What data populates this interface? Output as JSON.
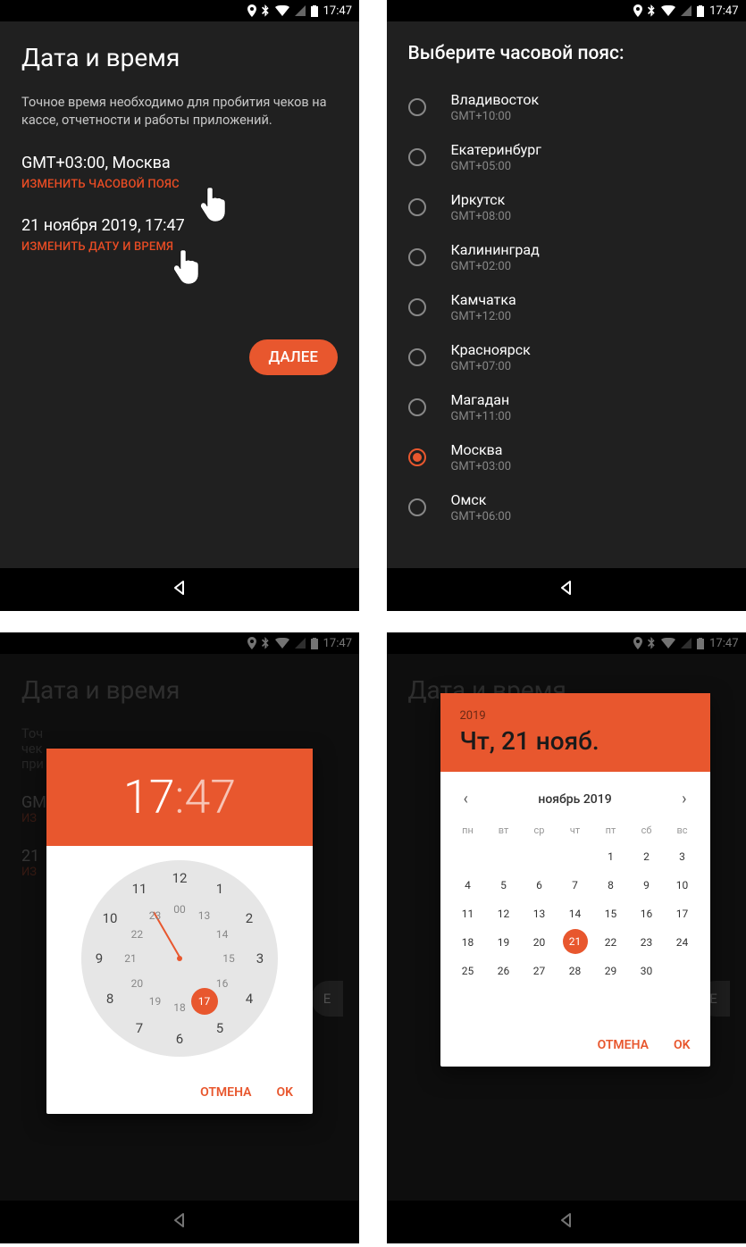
{
  "accent": "#e8572e",
  "status": {
    "time": "17:47"
  },
  "screen1": {
    "title": "Дата и время",
    "desc": "Точное время необходимо для пробития чеков на кассе, отчетности и работы приложений.",
    "tz_value": "GMT+03:00, Москва",
    "tz_link": "ИЗМЕНИТЬ ЧАСОВОЙ ПОЯС",
    "dt_value": "21 ноября 2019, 17:47",
    "dt_link": "ИЗМЕНИТЬ ДАТУ И ВРЕМЯ",
    "next": "ДАЛЕЕ"
  },
  "screen2": {
    "title": "Выберите часовой пояс:",
    "items": [
      {
        "name": "Владивосток",
        "gmt": "GMT+10:00",
        "selected": false
      },
      {
        "name": "Екатеринбург",
        "gmt": "GMT+05:00",
        "selected": false
      },
      {
        "name": "Иркутск",
        "gmt": "GMT+08:00",
        "selected": false
      },
      {
        "name": "Калининград",
        "gmt": "GMT+02:00",
        "selected": false
      },
      {
        "name": "Камчатка",
        "gmt": "GMT+12:00",
        "selected": false
      },
      {
        "name": "Красноярск",
        "gmt": "GMT+07:00",
        "selected": false
      },
      {
        "name": "Магадан",
        "gmt": "GMT+11:00",
        "selected": false
      },
      {
        "name": "Москва",
        "gmt": "GMT+03:00",
        "selected": true
      },
      {
        "name": "Омск",
        "gmt": "GMT+06:00",
        "selected": false
      }
    ]
  },
  "screen3": {
    "bg_title": "Дата и время",
    "bg_prefix1": "Точ",
    "bg_prefix2": "чек",
    "bg_prefix3": "при",
    "bg_prefix4": "GM",
    "bg_prefix5": "ИЗ",
    "bg_prefix6": "21",
    "bg_prefix7": "ИЗ",
    "hours": "17",
    "minutes": "47",
    "outer": [
      "12",
      "1",
      "2",
      "3",
      "4",
      "5",
      "6",
      "7",
      "8",
      "9",
      "10",
      "11"
    ],
    "inner": [
      "00",
      "13",
      "14",
      "15",
      "16",
      "17",
      "18",
      "19",
      "20",
      "21",
      "22",
      "23"
    ],
    "selected_inner": "17",
    "cancel": "ОТМЕНА",
    "ok": "OK",
    "peek": "Е"
  },
  "screen4": {
    "bg_title": "Дата и время",
    "year": "2019",
    "date_label": "Чт, 21 нояб.",
    "month_label": "ноябрь 2019",
    "weekdays": [
      "пн",
      "вт",
      "ср",
      "чт",
      "пт",
      "сб",
      "вс"
    ],
    "first_weekday_index": 4,
    "days_in_month": 30,
    "selected_day": 21,
    "cancel": "ОТМЕНА",
    "ok": "OK",
    "peek": "Е"
  }
}
